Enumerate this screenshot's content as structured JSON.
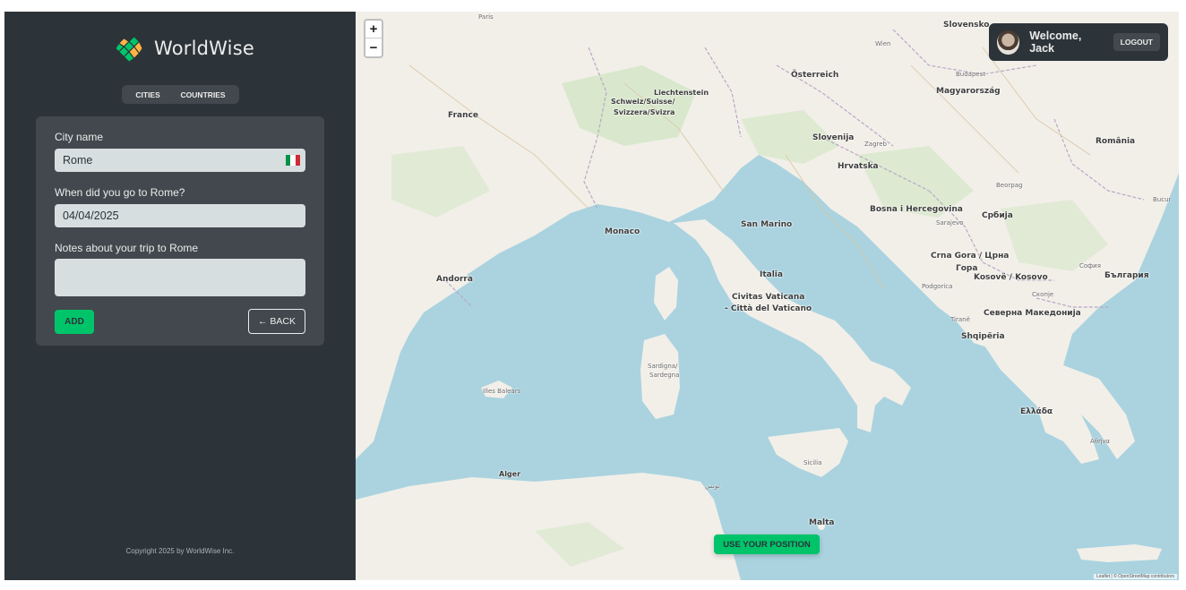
{
  "brand": {
    "name": "WorldWise"
  },
  "nav": [
    {
      "label": "Cities"
    },
    {
      "label": "Countries"
    }
  ],
  "form": {
    "city_label": "City name",
    "city_value": "Rome",
    "date_label": "When did you go to Rome?",
    "date_value": "04/04/2025",
    "notes_label": "Notes about your trip to Rome",
    "notes_value": "",
    "add_label": "Add",
    "back_label": "← Back"
  },
  "footer": {
    "copyright": "Copyright 2025 by WorldWise Inc."
  },
  "user": {
    "welcome": "Welcome, Jack",
    "logout": "Logout"
  },
  "map": {
    "zoom_in": "+",
    "zoom_out": "−",
    "use_position": "Use your position",
    "attribution": "Leaflet | © OpenStreetMap contributors",
    "labels": [
      {
        "text": "Paris"
      },
      {
        "text": "France"
      },
      {
        "text": "Liechtenstein"
      },
      {
        "text": "Schweiz/Suisse/"
      },
      {
        "text": "Svizzera/Svizra"
      },
      {
        "text": "Wien"
      },
      {
        "text": "Österreich"
      },
      {
        "text": "Slovensko"
      },
      {
        "text": "Budapest"
      },
      {
        "text": "Magyarország"
      },
      {
        "text": "Slovenija"
      },
      {
        "text": "Zagreb"
      },
      {
        "text": "Hrvatska"
      },
      {
        "text": "România"
      },
      {
        "text": "Beorpag"
      },
      {
        "text": "Bosna i Hercegovina"
      },
      {
        "text": "Sarajevo"
      },
      {
        "text": "Србија"
      },
      {
        "text": "Monaco"
      },
      {
        "text": "San Marino"
      },
      {
        "text": "Italia"
      },
      {
        "text": "Andorra"
      },
      {
        "text": "Civitas Vaticana"
      },
      {
        "text": "- Città del Vaticano"
      },
      {
        "text": "Crna Gora / Црна"
      },
      {
        "text": "Гора"
      },
      {
        "text": "Kosovë / Kosovo"
      },
      {
        "text": "София"
      },
      {
        "text": "България"
      },
      {
        "text": "Podgorica"
      },
      {
        "text": "Скопје"
      },
      {
        "text": "Северна Македонија"
      },
      {
        "text": "Tiranë"
      },
      {
        "text": "Shqipëria"
      },
      {
        "text": "Ελλάδα"
      },
      {
        "text": "Αθήνα"
      },
      {
        "text": "Alger"
      },
      {
        "text": "تونس"
      },
      {
        "text": "Malta"
      },
      {
        "text": "Sardigna/"
      },
      {
        "text": "Sardegna"
      },
      {
        "text": "Illes Balears"
      },
      {
        "text": "Sicilia"
      },
      {
        "text": "Bucur"
      }
    ]
  }
}
